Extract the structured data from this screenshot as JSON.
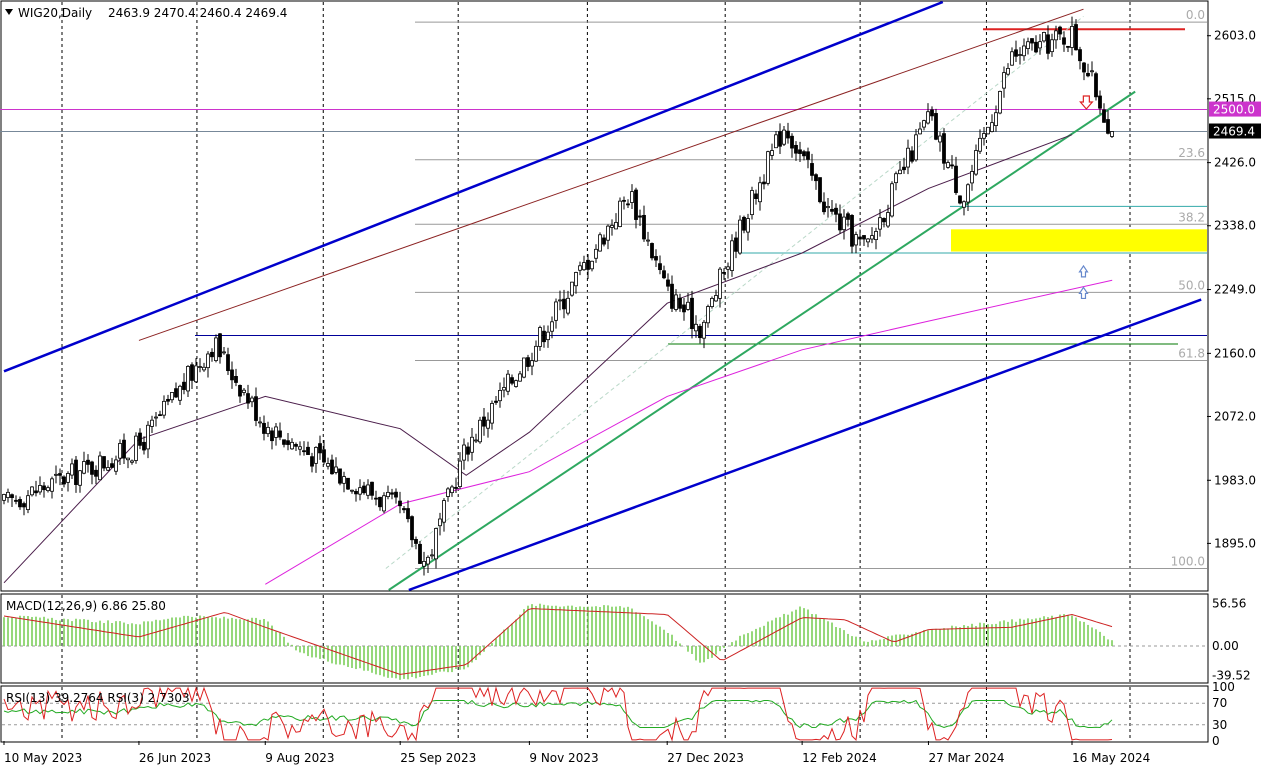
{
  "chart_data": [
    {
      "type": "candlestick",
      "title": "WIG20,Daily",
      "ohlc_label": "2463.9 2470.4 2460.4 2469.4",
      "last_price": 2469.4,
      "last_price_label": "2469.4",
      "ylim": [
        1830,
        2650
      ],
      "y_ticks": [
        {
          "value": 2603,
          "label": "2603.0"
        },
        {
          "value": 2515,
          "label": "2515.0"
        },
        {
          "value": 2426,
          "label": "2426.0"
        },
        {
          "value": 2338,
          "label": "2338.0"
        },
        {
          "value": 2249,
          "label": "2249.0"
        },
        {
          "value": 2160,
          "label": "2160.0"
        },
        {
          "value": 2072,
          "label": "2072.0"
        },
        {
          "value": 1983,
          "label": "1983.0"
        },
        {
          "value": 1895,
          "label": "1895.0"
        }
      ],
      "x_ticks": [
        "10 May 2023",
        "26 Jun 2023",
        "9 Aug 2023",
        "25 Sep 2023",
        "9 Nov 2023",
        "27 Dec 2023",
        "12 Feb 2024",
        "27 Mar 2024",
        "16 May 2024"
      ],
      "close_path": [
        {
          "date": "10 May 2023",
          "value": 1950
        },
        {
          "date": "26 Jun 2023",
          "value": 2030
        },
        {
          "date": "22 Jul 2023",
          "value": 2175
        },
        {
          "date": "9 Aug 2023",
          "value": 2060
        },
        {
          "date": "25 Sep 2023",
          "value": 1940
        },
        {
          "date": "4 Oct 2023",
          "value": 1865
        },
        {
          "date": "18 Oct 2023",
          "value": 2030
        },
        {
          "date": "9 Nov 2023",
          "value": 2160
        },
        {
          "date": "14 Dec 2023",
          "value": 2385
        },
        {
          "date": "27 Dec 2023",
          "value": 2245
        },
        {
          "date": "8 Jan 2024",
          "value": 2195
        },
        {
          "date": "22 Jan 2024",
          "value": 2340
        },
        {
          "date": "6 Feb 2024",
          "value": 2480
        },
        {
          "date": "21 Feb 2024",
          "value": 2360
        },
        {
          "date": "5 Mar 2024",
          "value": 2305
        },
        {
          "date": "27 Mar 2024",
          "value": 2490
        },
        {
          "date": "8 Apr 2024",
          "value": 2375
        },
        {
          "date": "25 Apr 2024",
          "value": 2575
        },
        {
          "date": "16 May 2024",
          "value": 2605
        },
        {
          "date": "30 May 2024",
          "value": 2469.4
        }
      ],
      "moving_averages": [
        {
          "color": "#4b1e4b",
          "points": [
            {
              "date": "10 May 2023",
              "value": 1840
            },
            {
              "date": "26 Jun 2023",
              "value": 2040
            },
            {
              "date": "9 Aug 2023",
              "value": 2100
            },
            {
              "date": "25 Sep 2023",
              "value": 2055
            },
            {
              "date": "18 Oct 2023",
              "value": 1990
            },
            {
              "date": "9 Nov 2023",
              "value": 2050
            },
            {
              "date": "27 Dec 2023",
              "value": 2230
            },
            {
              "date": "12 Feb 2024",
              "value": 2300
            },
            {
              "date": "27 Mar 2024",
              "value": 2390
            },
            {
              "date": "16 May 2024",
              "value": 2465
            }
          ]
        },
        {
          "color": "#dd22dd",
          "points": [
            {
              "date": "9 Aug 2023",
              "value": 1838
            },
            {
              "date": "25 Sep 2023",
              "value": 1950
            },
            {
              "date": "9 Nov 2023",
              "value": 1995
            },
            {
              "date": "27 Dec 2023",
              "value": 2100
            },
            {
              "date": "12 Feb 2024",
              "value": 2165
            },
            {
              "date": "27 Mar 2024",
              "value": 2205
            },
            {
              "date": "30 May 2024",
              "value": 2262
            }
          ]
        }
      ],
      "fibonacci_levels": [
        {
          "label": "0.0",
          "value": 2622
        },
        {
          "label": "23.6",
          "value": 2430
        },
        {
          "label": "38.2",
          "value": 2340
        },
        {
          "label": "50.0",
          "value": 2245
        },
        {
          "label": "61.8",
          "value": 2150
        },
        {
          "label": "100.0",
          "value": 1860
        }
      ],
      "horizontal_lines": [
        {
          "value": 2500,
          "label": "2500.0",
          "color": "#cc33cc"
        },
        {
          "value": 2612,
          "color": "#dd2222"
        },
        {
          "value": 2185,
          "color": "#000099"
        },
        {
          "value": 2173,
          "color": "#007700"
        },
        {
          "value": 2300,
          "color": "#33aaaa"
        },
        {
          "value": 2365,
          "color": "#33aaaa"
        },
        {
          "value": 2469.4,
          "color": "#778899"
        }
      ],
      "zone": {
        "from": 2302,
        "to": 2333,
        "color": "#ffff00"
      },
      "trendlines": [
        {
          "color": "#0000cc",
          "from": {
            "date": "10 May 2023",
            "value": 2135
          },
          "to": {
            "date": "1 Apr 2024",
            "value": 2650
          }
        },
        {
          "color": "#0000cc",
          "from": {
            "date": "28 Sep 2023",
            "value": 1830
          },
          "to": {
            "date": "30 Jun 2024",
            "value": 2235
          }
        },
        {
          "color": "#2ea860",
          "from": {
            "date": "21 Sep 2023",
            "value": 1830
          },
          "to": {
            "date": "7 Jun 2024",
            "value": 2525
          }
        },
        {
          "color": "#8b2222",
          "from": {
            "date": "26 Jun 2023",
            "value": 2178
          },
          "to": {
            "date": "20 May 2024",
            "value": 2640
          }
        }
      ],
      "arrows": [
        {
          "direction": "down",
          "date": "21 May 2024",
          "value": 2505,
          "color": "#dd2222"
        },
        {
          "direction": "up",
          "date": "20 May 2024",
          "value": 2275,
          "color": "#6688cc"
        },
        {
          "direction": "up",
          "date": "20 May 2024",
          "value": 2245,
          "color": "#6688cc"
        }
      ]
    },
    {
      "type": "bar+line",
      "title": "MACD(12,26,9) 6.86 25.80",
      "ylim": [
        -48,
        68
      ],
      "y_ticks": [
        {
          "value": 56.56,
          "label": "56.56"
        },
        {
          "value": 0,
          "label": "0.00"
        },
        {
          "value": -39.52,
          "label": "-39.52"
        }
      ],
      "histogram_path": [
        {
          "date": "10 May 2023",
          "value": 40
        },
        {
          "date": "26 Jun 2023",
          "value": 30
        },
        {
          "date": "10 Jul 2023",
          "value": 40
        },
        {
          "date": "9 Aug 2023",
          "value": 35
        },
        {
          "date": "21 Aug 2023",
          "value": -10
        },
        {
          "date": "25 Sep 2023",
          "value": -45
        },
        {
          "date": "18 Oct 2023",
          "value": -30
        },
        {
          "date": "9 Nov 2023",
          "value": 55
        },
        {
          "date": "14 Dec 2023",
          "value": 52
        },
        {
          "date": "27 Dec 2023",
          "value": 20
        },
        {
          "date": "8 Jan 2024",
          "value": -25
        },
        {
          "date": "22 Jan 2024",
          "value": 15
        },
        {
          "date": "12 Feb 2024",
          "value": 52
        },
        {
          "date": "5 Mar 2024",
          "value": 5
        },
        {
          "date": "27 Mar 2024",
          "value": 22
        },
        {
          "date": "16 May 2024",
          "value": 42
        },
        {
          "date": "30 May 2024",
          "value": 6.86
        }
      ],
      "signal_path": [
        {
          "date": "10 May 2023",
          "value": 40
        },
        {
          "date": "26 Jun 2023",
          "value": 12
        },
        {
          "date": "26 Jul 2023",
          "value": 45
        },
        {
          "date": "9 Aug 2023",
          "value": 25
        },
        {
          "date": "25 Sep 2023",
          "value": -38
        },
        {
          "date": "18 Oct 2023",
          "value": -25
        },
        {
          "date": "9 Nov 2023",
          "value": 50
        },
        {
          "date": "27 Dec 2023",
          "value": 42
        },
        {
          "date": "15 Jan 2024",
          "value": -20
        },
        {
          "date": "12 Feb 2024",
          "value": 38
        },
        {
          "date": "27 Feb 2024",
          "value": 35
        },
        {
          "date": "15 Mar 2024",
          "value": 5
        },
        {
          "date": "27 Mar 2024",
          "value": 22
        },
        {
          "date": "25 Apr 2024",
          "value": 25
        },
        {
          "date": "16 May 2024",
          "value": 42
        },
        {
          "date": "30 May 2024",
          "value": 25.8
        }
      ]
    },
    {
      "type": "line",
      "title": "RSI(13) 39.2764  RSI(3) 2.7303",
      "ylim": [
        0,
        100
      ],
      "y_ticks": [
        {
          "value": 100,
          "label": "100"
        },
        {
          "value": 70,
          "label": "70"
        },
        {
          "value": 30,
          "label": "30"
        },
        {
          "value": 0,
          "label": "0"
        }
      ],
      "series": [
        {
          "name": "RSI(13)",
          "color": "#22aa22",
          "last": 39.2764
        },
        {
          "name": "RSI(3)",
          "color": "#dd2222",
          "last": 2.7303
        }
      ]
    }
  ]
}
